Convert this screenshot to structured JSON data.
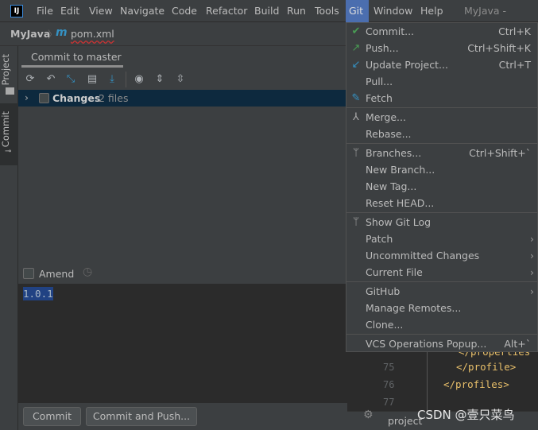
{
  "app": {
    "logo": "IJ",
    "window_title": "MyJava - pom.x"
  },
  "menubar": [
    "File",
    "Edit",
    "View",
    "Navigate",
    "Code",
    "Refactor",
    "Build",
    "Run",
    "Tools",
    "Git",
    "Window",
    "Help"
  ],
  "breadcrumb": {
    "project": "MyJava",
    "file_icon": "m",
    "file": "pom.xml"
  },
  "side_tabs": {
    "project": "Project",
    "commit": "Commit"
  },
  "commit_panel": {
    "tab": "Commit to master",
    "toolbar_icons": [
      "refresh-icon",
      "rollback-icon",
      "diff-icon",
      "changelist-icon",
      "update-icon",
      "view-options-icon",
      "expand-all-icon",
      "collapse-all-icon"
    ],
    "changes_label": "Changes",
    "changes_count": "2 files",
    "amend_label": "Amend",
    "message": "1.0.1",
    "commit_button": "Commit",
    "commit_push_button": "Commit and Push..."
  },
  "editor": {
    "lines": [
      {
        "n": "75",
        "code": "</profile>"
      },
      {
        "n": "76",
        "code": "</profiles>"
      },
      {
        "n": "77",
        "code": ""
      }
    ],
    "partial": "</properties"
  },
  "bottom": {
    "project_label": "project",
    "watermark": "CSDN @壹只菜鸟"
  },
  "git_menu": [
    [
      {
        "label": "Commit...",
        "shortcut": "Ctrl+K",
        "icon": "check-icon",
        "color": "#499c54"
      },
      {
        "label": "Push...",
        "shortcut": "Ctrl+Shift+K",
        "icon": "push-arrow-icon",
        "color": "#499c54"
      },
      {
        "label": "Update Project...",
        "shortcut": "Ctrl+T",
        "icon": "update-arrow-icon",
        "color": "#3592c4"
      },
      {
        "label": "Pull...",
        "shortcut": ""
      },
      {
        "label": "Fetch",
        "shortcut": "",
        "icon": "fetch-icon",
        "color": "#3592c4"
      }
    ],
    [
      {
        "label": "Merge...",
        "icon": "merge-icon",
        "color": "#aaaaaa"
      },
      {
        "label": "Rebase..."
      }
    ],
    [
      {
        "label": "Branches...",
        "shortcut": "Ctrl+Shift+`",
        "icon": "branch-icon",
        "color": "#aaaaaa"
      },
      {
        "label": "New Branch..."
      },
      {
        "label": "New Tag..."
      },
      {
        "label": "Reset HEAD..."
      }
    ],
    [
      {
        "label": "Show Git Log",
        "icon": "branch-icon",
        "color": "#aaaaaa"
      },
      {
        "label": "Patch",
        "submenu": true
      },
      {
        "label": "Uncommitted Changes",
        "submenu": true
      },
      {
        "label": "Current File",
        "submenu": true
      }
    ],
    [
      {
        "label": "GitHub",
        "submenu": true
      },
      {
        "label": "Manage Remotes..."
      },
      {
        "label": "Clone..."
      }
    ],
    [
      {
        "label": "VCS Operations Popup...",
        "shortcut": "Alt+`"
      }
    ]
  ]
}
